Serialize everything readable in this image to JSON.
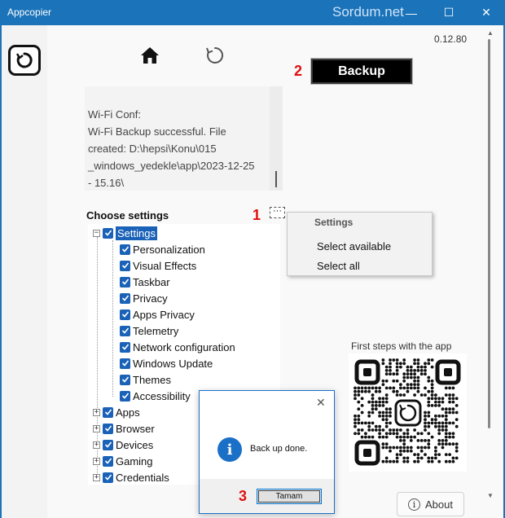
{
  "window": {
    "title": "Appcopier",
    "watermark": "Sordum.net",
    "controls": {
      "minimize": "—",
      "maximize": "☐",
      "close": "✕"
    }
  },
  "app": {
    "version": "0.12.80",
    "nav": {
      "home_icon": "home-icon",
      "refresh_icon": "refresh-icon"
    },
    "backup_label": "Backup",
    "markers": {
      "one": "1",
      "two": "2",
      "three": "3"
    }
  },
  "log": {
    "lines": [
      "Wi-Fi Conf:",
      "Wi-Fi Backup successful. File",
      "created: D:\\hepsi\\Konu\\015",
      "_windows_yedekle\\app\\2023-12-25",
      "- 15.16\\"
    ]
  },
  "tree": {
    "heading": "Choose settings",
    "more_button": "···",
    "root": "Settings",
    "children": [
      "Personalization",
      "Visual Effects",
      "Taskbar",
      "Privacy",
      "Apps Privacy",
      "Telemetry",
      "Network configuration",
      "Windows Update",
      "Themes",
      "Accessibility"
    ],
    "siblings": [
      "Apps",
      "Browser",
      "Devices",
      "Gaming",
      "Credentials"
    ]
  },
  "menu": {
    "header": "Settings",
    "items": [
      "Select available",
      "Select all"
    ]
  },
  "qr": {
    "caption": "First steps with the app"
  },
  "about_label": "About",
  "dialog": {
    "message": "Back up done.",
    "ok_label": "Tamam",
    "close": "✕",
    "icon_glyph": "i"
  },
  "colors": {
    "accent": "#1a62b7",
    "titlebar": "#1b73b9",
    "marker": "#e01010"
  }
}
